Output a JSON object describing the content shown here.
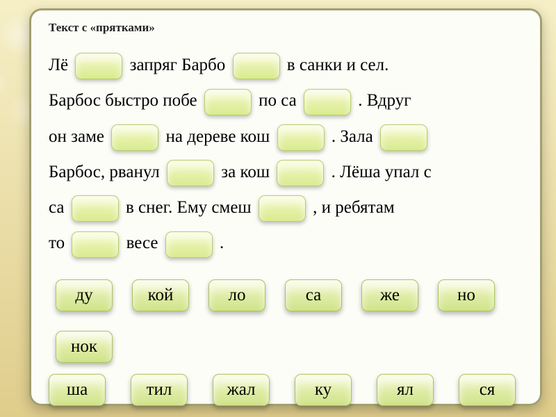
{
  "title": "Текст с «прятками»",
  "lines": [
    {
      "parts": [
        "Лё ",
        null,
        "  запряг Барбо ",
        null,
        "  в санки и сел."
      ]
    },
    {
      "parts": [
        "Барбос быстро побе ",
        null,
        "  по са ",
        null,
        " .  Вдруг"
      ]
    },
    {
      "parts": [
        "он заме ",
        null,
        "  на дереве кош ",
        null,
        " . Зала ",
        null
      ]
    },
    {
      "parts": [
        "Барбос, рванул ",
        null,
        "  за кош ",
        null,
        " . Лёша упал с"
      ]
    },
    {
      "parts": [
        "са ",
        null,
        "  в снег. Ему  смеш ",
        null,
        " , и ребятам"
      ]
    },
    {
      "parts": [
        "то ",
        null,
        "   весе ",
        null,
        " ."
      ]
    }
  ],
  "chips_row1": [
    "ду",
    "кой",
    "ло",
    "са",
    "же",
    "но",
    "нок"
  ],
  "chips_row2": [
    "ша",
    "тил",
    "жал",
    "ку",
    "ял",
    "ся"
  ]
}
